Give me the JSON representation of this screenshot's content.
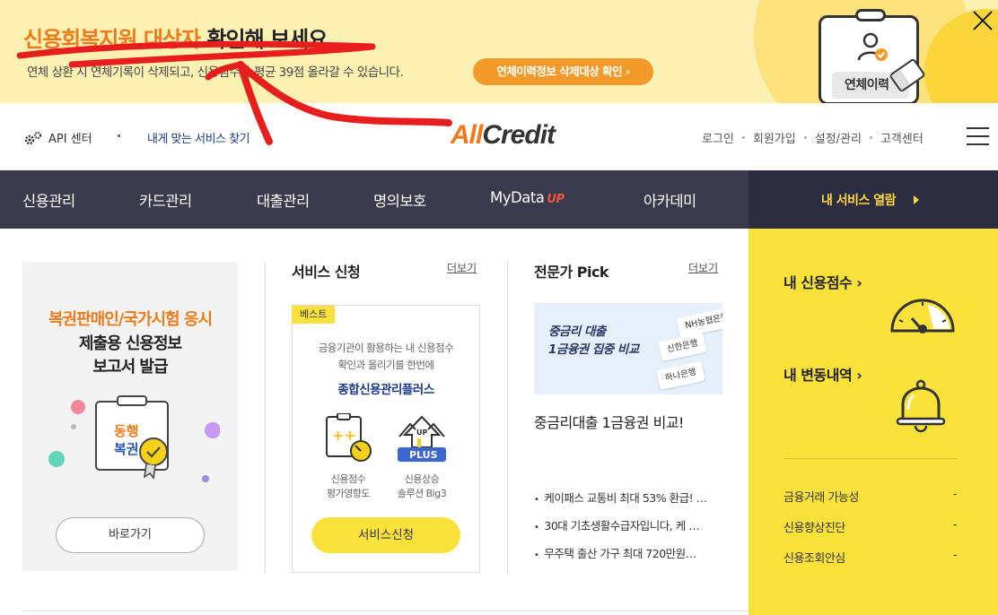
{
  "banner": {
    "title_highlight": "신용회복지원 대상자",
    "title_rest": " 확인해 보세요",
    "subtitle": "연체 상환 시 연체기록이 삭제되고, 신용점수가 평균 39점 올라갈 수 있습니다.",
    "button_label": "연체이력정보 삭제대상 확인 ›",
    "clipboard_label": "연체이력"
  },
  "header": {
    "api_label": "API 센터",
    "my_services": "내게 맞는 서비스 찾기",
    "logo_all": "All",
    "logo_credit": "Credit",
    "util_links": [
      "로그인",
      "회원가입",
      "설정/관리",
      "고객센터"
    ]
  },
  "nav": {
    "items": [
      "신용관리",
      "카드관리",
      "대출관리",
      "명의보호",
      "MyData",
      "아카데미"
    ],
    "mydata_badge": "UP",
    "open_services": "내 서비스 열람"
  },
  "promo": {
    "line1": "복권판매인/국가시험 응시",
    "line2": "제출용 신용정보",
    "line3": "보고서 발급",
    "logo_top": "동행",
    "logo_bottom": "복권",
    "button": "바로가기"
  },
  "service": {
    "title": "서비스 신청",
    "more": "더보기",
    "badge": "베스트",
    "desc_line1": "금융기관이 활용하는 내 신용점수",
    "desc_line2": "확인과 올리기를 한번에",
    "name": "종합신용관리플러스",
    "icon1_line1": "신용점수",
    "icon1_line2": "평가영향도",
    "icon2_line1": "신용상승",
    "icon2_line2": "솔루션 Big3",
    "icon2_up": "UP",
    "icon2_plus": "PLUS",
    "button": "서비스신청"
  },
  "expert": {
    "title": "전문가 Pick",
    "more": "더보기",
    "image_line1": "중금리 대출",
    "image_line2": "1금융권 집중 비교",
    "banks": [
      "NH농협은행",
      "신한은행",
      "하나은행"
    ],
    "headline": "중금리대출 1금융권 비교!",
    "list": [
      "케이패스 교통비 최대 53% 환급! …",
      "30대 기초생활수급자입니다, 케 …",
      "무주택 출산 가구 최대 720만원…"
    ]
  },
  "side": {
    "score_title": "내 신용점수 ›",
    "history_title": "내 변동내역 ›",
    "rows": [
      {
        "label": "금융거래 가능성",
        "value": "-"
      },
      {
        "label": "신용향상진단",
        "value": "-"
      },
      {
        "label": "신용조회안심",
        "value": "-"
      }
    ]
  },
  "colors": {
    "accent_orange": "#ee7a1b",
    "nav_dark": "#3a3a4d",
    "side_yellow": "#fbe23a",
    "banner_bg": "#fdf0b3",
    "annotation_red": "#e81e1e"
  },
  "icons": [
    "close-icon",
    "gear-icon",
    "hamburger-icon",
    "gauge-icon",
    "bell-icon",
    "user-check-icon",
    "eraser-icon"
  ]
}
